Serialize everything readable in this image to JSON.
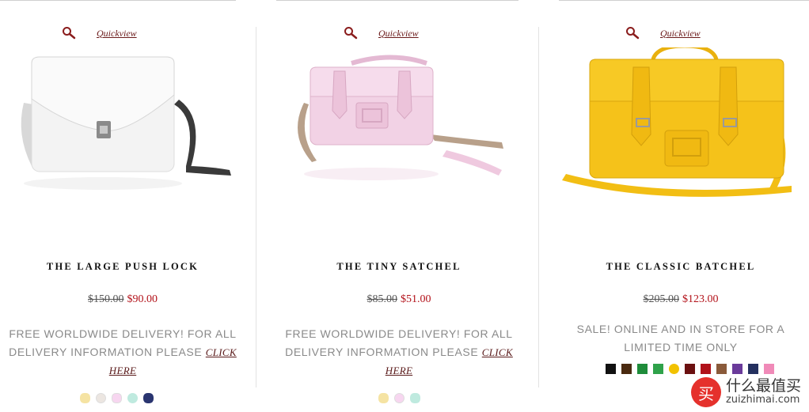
{
  "products": [
    {
      "quickview": "Quickview",
      "title": "THE LARGE PUSH LOCK",
      "old_price": "$150.00",
      "new_price": "$90.00",
      "desc_line1": "FREE WORLDWIDE DELIVERY! FOR ALL",
      "desc_line2": "DELIVERY INFORMATION PLEASE",
      "link_text1": "CLICK",
      "link_text2": "HERE",
      "bag_color": "#f2f2f2",
      "swatches": [
        "#f5e3a3",
        "#ece6e1",
        "#f7d6f0",
        "#bfeadf",
        "#2a3570"
      ]
    },
    {
      "quickview": "Quickview",
      "title": "THE TINY SATCHEL",
      "old_price": "$85.00",
      "new_price": "$51.00",
      "desc_line1": "FREE WORLDWIDE DELIVERY! FOR ALL",
      "desc_line2": "DELIVERY INFORMATION PLEASE",
      "link_text1": "CLICK",
      "link_text2": "HERE",
      "bag_color": "#efcfe3",
      "swatches": [
        "#f5e3a3",
        "#f7d6f0",
        "#bfeadf"
      ]
    },
    {
      "quickview": "Quickview",
      "title": "THE CLASSIC BATCHEL",
      "old_price": "$205.00",
      "new_price": "$123.00",
      "desc_line1": "SALE! ONLINE AND IN STORE FOR A",
      "desc_line2": "LIMITED TIME ONLY",
      "bag_color": "#f5c21a",
      "swatches": [
        "#111111",
        "#4a2a10",
        "#1e8c3a",
        "#2fa24a",
        "#f2c200",
        "#6b1010",
        "#b1121a",
        "#8a5a3a",
        "#6a3a9a",
        "#24305f",
        "#f08ab8"
      ]
    }
  ],
  "watermark": {
    "logo": "买",
    "cn": "什么最值买",
    "en": "zuizhimai.com"
  }
}
